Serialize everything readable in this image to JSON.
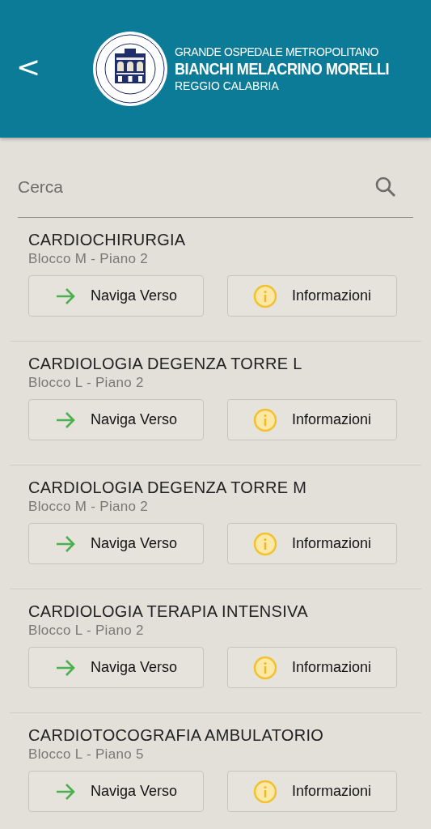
{
  "header": {
    "back": "<",
    "title_top": "GRANDE OSPEDALE METROPOLITANO",
    "title_main": "BIANCHI MELACRINO MORELLI",
    "title_sub": "REGGIO CALABRIA"
  },
  "search": {
    "placeholder": "Cerca"
  },
  "departments": [
    {
      "name": "CARDIOCHIRURGIA",
      "location": "Blocco M - Piano 2",
      "buttons": [
        {
          "kind": "navigate",
          "label": "Naviga Verso"
        },
        {
          "kind": "info",
          "label": "Informazioni"
        }
      ]
    },
    {
      "name": "CARDIOLOGIA DEGENZA TORRE L",
      "location": "Blocco L - Piano 2",
      "buttons": [
        {
          "kind": "navigate",
          "label": "Naviga Verso"
        },
        {
          "kind": "info",
          "label": "Informazioni"
        }
      ]
    },
    {
      "name": "CARDIOLOGIA DEGENZA TORRE M",
      "location": "Blocco M - Piano 2",
      "buttons": [
        {
          "kind": "navigate",
          "label": "Naviga Verso"
        },
        {
          "kind": "info",
          "label": "Informazioni"
        }
      ]
    },
    {
      "name": "CARDIOLOGIA TERAPIA INTENSIVA",
      "location": "Blocco L - Piano 2",
      "buttons": [
        {
          "kind": "navigate",
          "label": "Naviga Verso"
        },
        {
          "kind": "info",
          "label": "Informazioni"
        }
      ]
    },
    {
      "name": "CARDIOTOCOGRAFIA AMBULATORIO",
      "location": "Blocco L - Piano 5",
      "buttons": [
        {
          "kind": "navigate",
          "label": "Naviga Verso"
        },
        {
          "kind": "info",
          "label": "Informazioni"
        }
      ]
    }
  ]
}
